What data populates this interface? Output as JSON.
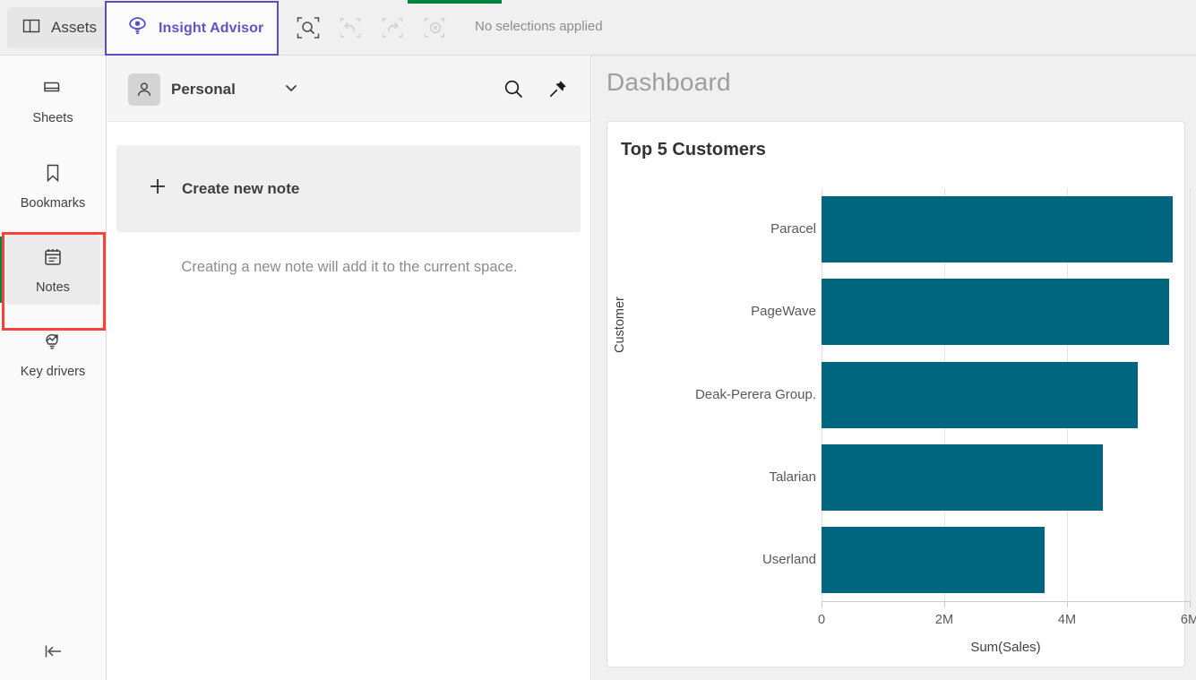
{
  "toolbar": {
    "assets_label": "Assets",
    "assets_icon": "panel-layout-icon",
    "insight_advisor_label": "Insight Advisor",
    "insight_advisor_icon": "insight-advisor-eye-bulb-icon",
    "selection_search_icon": "selection-search-icon",
    "undo_icon": "undo-icon",
    "redo_icon": "redo-icon",
    "clear_selections_icon": "clear-selections-icon",
    "selection_status": "No selections applied"
  },
  "progress": {
    "value_percent": 12
  },
  "sidebar": {
    "items": [
      {
        "label": "Sheets",
        "icon": "sheets-icon",
        "active": false
      },
      {
        "label": "Bookmarks",
        "icon": "bookmark-icon",
        "active": false
      },
      {
        "label": "Notes",
        "icon": "notes-calendar-icon",
        "active": true
      },
      {
        "label": "Key drivers",
        "icon": "key-drivers-bulb-arrow-icon",
        "active": false
      }
    ],
    "collapse_icon": "collapse-left-icon",
    "active_indicator_color": "#00873d",
    "annotation_color": "#f9423a"
  },
  "notes": {
    "owner_label": "Personal",
    "owner_icon": "person-avatar-icon",
    "owner_caret_icon": "chevron-down-icon",
    "search_icon": "search-icon",
    "pin_icon": "pin-icon",
    "create_label": "Create new note",
    "create_icon": "plus-icon",
    "hint": "Creating a new note will add it to the current space."
  },
  "dashboard": {
    "title": "Dashboard"
  },
  "chart_data": {
    "type": "bar",
    "orientation": "horizontal",
    "title": "Top 5 Customers",
    "xlabel": "Sum(Sales)",
    "ylabel": "Customer",
    "xlim": [
      0,
      6000000
    ],
    "xticks": [
      0,
      2000000,
      4000000,
      6000000
    ],
    "xtick_labels": [
      "0",
      "2M",
      "4M",
      "6M"
    ],
    "grid": true,
    "legend": "none",
    "bar_color": "#006680",
    "categories": [
      "Paracel",
      "PageWave",
      "Deak-Perera Group.",
      "Talarian",
      "Userland"
    ],
    "values": [
      5720000,
      5660000,
      5160000,
      4580000,
      3630000
    ]
  }
}
